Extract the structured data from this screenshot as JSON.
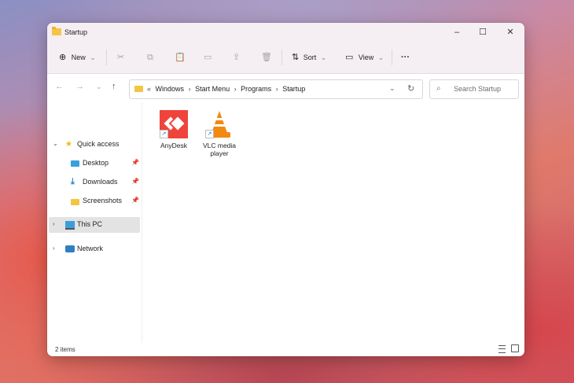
{
  "window": {
    "title": "Startup",
    "controls": {
      "minimize": "–",
      "maximize": "☐",
      "close": "✕"
    }
  },
  "commandbar": {
    "new_label": "New",
    "new_icon": "⊕",
    "dropdown_glyph": "⌄",
    "cut_icon": "✂",
    "copy_icon": "⧉",
    "paste_icon": "📋",
    "rename_icon": "▭",
    "share_icon": "⇪",
    "delete_icon": "🗑",
    "sort_icon": "⇅",
    "sort_label": "Sort",
    "view_icon": "▭",
    "view_label": "View",
    "more_label": "···"
  },
  "navigation": {
    "back_icon": "←",
    "forward_icon": "→",
    "recent_icon": "⌄",
    "up_icon": "↑",
    "overflow": "«",
    "breadcrumbs": [
      "Windows",
      "Start Menu",
      "Programs",
      "Startup"
    ],
    "separator": "›",
    "dropdown_icon": "⌄",
    "refresh_icon": "↻"
  },
  "search": {
    "icon": "⌕",
    "placeholder": "Search Startup"
  },
  "sidebar": {
    "expand_open": "⌄",
    "expand_closed": "›",
    "pin_icon": "📌",
    "quick_access": "Quick access",
    "items": [
      "Desktop",
      "Downloads",
      "Screenshots"
    ],
    "download_glyph": "⤓",
    "this_pc": "This PC",
    "network": "Network"
  },
  "files": [
    {
      "name": "AnyDesk",
      "shortcut_glyph": "↗"
    },
    {
      "name": "VLC media player",
      "shortcut_glyph": "↗"
    }
  ],
  "status": {
    "item_count": "2 items"
  }
}
